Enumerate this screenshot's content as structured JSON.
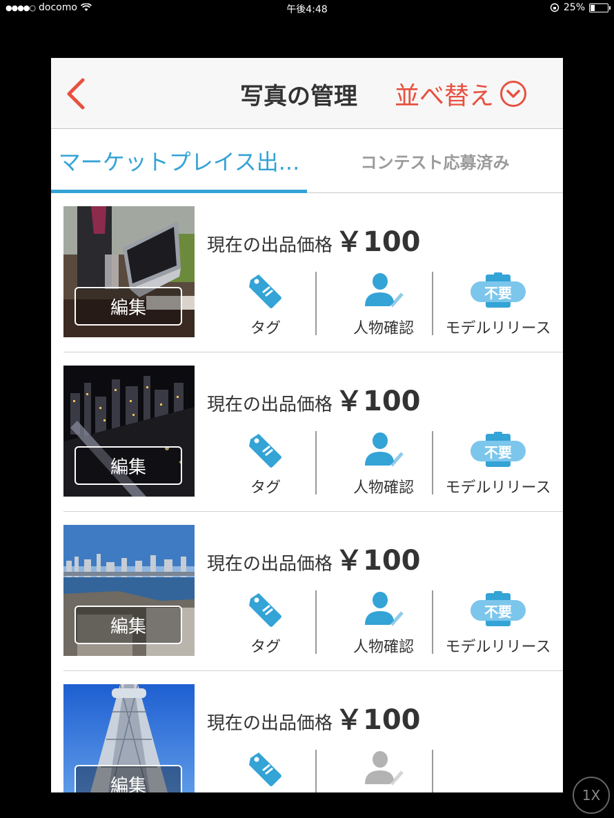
{
  "status_bar": {
    "signal": "●●●●○",
    "carrier": "docomo",
    "time": "午後4:48",
    "battery": "25%",
    "battery_level": 0.25
  },
  "nav": {
    "title": "写真の管理",
    "sort_label": "並べ替え",
    "back_icon": "chevron-left-icon",
    "sort_icon": "chevron-down-circle-icon"
  },
  "tabs": [
    {
      "label": "マーケットプレイス出...",
      "active": true
    },
    {
      "label": "コンテスト応募済み",
      "active": false
    }
  ],
  "photos": [
    {
      "price_label": "現在の出品価格",
      "price": "￥100",
      "edit_label": "編集",
      "tag_label": "タグ",
      "person_label": "人物確認",
      "release_label": "モデルリリース",
      "release_badge": "不要",
      "person_confirmed": true,
      "scene": "laptop"
    },
    {
      "price_label": "現在の出品価格",
      "price": "￥100",
      "edit_label": "編集",
      "tag_label": "タグ",
      "person_label": "人物確認",
      "release_label": "モデルリリース",
      "release_badge": "不要",
      "person_confirmed": true,
      "scene": "night-city"
    },
    {
      "price_label": "現在の出品価格",
      "price": "￥100",
      "edit_label": "編集",
      "tag_label": "タグ",
      "person_label": "人物確認",
      "release_label": "モデルリリース",
      "release_badge": "不要",
      "person_confirmed": true,
      "scene": "bay-city"
    },
    {
      "price_label": "現在の出品価格",
      "price": "￥100",
      "edit_label": "編集",
      "tag_label": "",
      "person_label": "",
      "release_label": "",
      "release_badge": "",
      "person_confirmed": false,
      "scene": "tower"
    }
  ],
  "zoom_button": "1X",
  "colors": {
    "accent_blue": "#34a3d6",
    "accent_red": "#e8503f",
    "grey_icon": "#b3b3b3"
  }
}
